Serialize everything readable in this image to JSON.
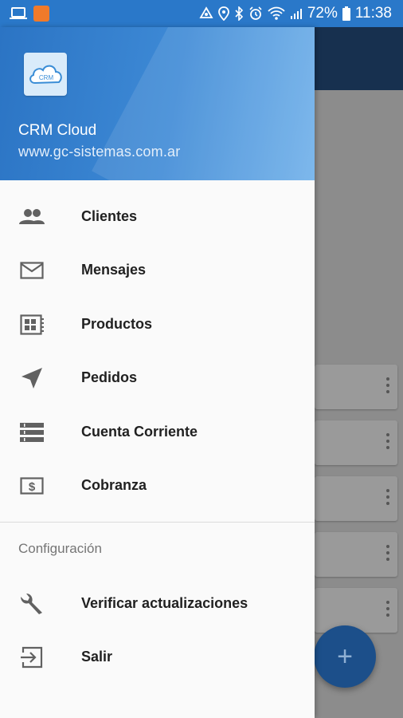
{
  "status_bar": {
    "battery": "72%",
    "time": "11:38"
  },
  "header": {
    "app_name": "CRM Cloud",
    "url": "www.gc-sistemas.com.ar",
    "logo_text": "CRM"
  },
  "menu": {
    "items": [
      {
        "label": "Clientes",
        "icon": "people-icon"
      },
      {
        "label": "Mensajes",
        "icon": "mail-icon"
      },
      {
        "label": "Productos",
        "icon": "product-icon"
      },
      {
        "label": "Pedidos",
        "icon": "send-icon"
      },
      {
        "label": "Cuenta Corriente",
        "icon": "list-icon"
      },
      {
        "label": "Cobranza",
        "icon": "money-icon"
      }
    ],
    "section_title": "Configuración",
    "config_items": [
      {
        "label": "Verificar actualizaciones",
        "icon": "wrench-icon"
      },
      {
        "label": "Salir",
        "icon": "exit-icon"
      }
    ]
  },
  "colors": {
    "status_bar": "#2a78c9",
    "header_start": "#2b74c4",
    "header_end": "#6fb0ea",
    "icon": "#616161",
    "fab": "#1c4f8a"
  },
  "fab": {
    "symbol": "+"
  }
}
